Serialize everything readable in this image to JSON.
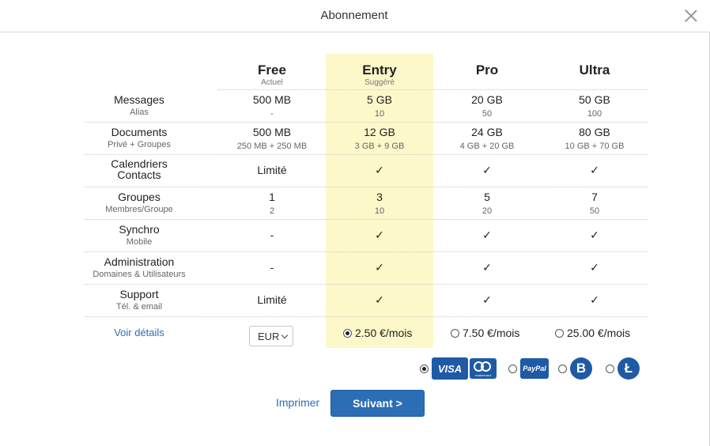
{
  "dialog": {
    "title": "Abonnement"
  },
  "plans": [
    {
      "name": "Free",
      "sub": "Actuel"
    },
    {
      "name": "Entry",
      "sub": "Suggéré"
    },
    {
      "name": "Pro",
      "sub": ""
    },
    {
      "name": "Ultra",
      "sub": ""
    }
  ],
  "rows": [
    {
      "label": "Messages",
      "label_sub": "Alias",
      "cells": [
        {
          "main": "500 MB",
          "sub": "-"
        },
        {
          "main": "5 GB",
          "sub": "10"
        },
        {
          "main": "20 GB",
          "sub": "50"
        },
        {
          "main": "50 GB",
          "sub": "100"
        }
      ]
    },
    {
      "label": "Documents",
      "label_sub": "Privé + Groupes",
      "cells": [
        {
          "main": "500 MB",
          "sub": "250 MB + 250 MB"
        },
        {
          "main": "12 GB",
          "sub": "3 GB + 9 GB"
        },
        {
          "main": "24 GB",
          "sub": "4 GB + 20 GB"
        },
        {
          "main": "80 GB",
          "sub": "10 GB + 70 GB"
        }
      ]
    },
    {
      "label": "Calendriers",
      "label_sub": "Contacts",
      "cells": [
        {
          "main": "Limité",
          "sub": ""
        },
        {
          "main": "✓",
          "sub": ""
        },
        {
          "main": "✓",
          "sub": ""
        },
        {
          "main": "✓",
          "sub": ""
        }
      ]
    },
    {
      "label": "Groupes",
      "label_sub": "Membres/Groupe",
      "cells": [
        {
          "main": "1",
          "sub": "2"
        },
        {
          "main": "3",
          "sub": "10"
        },
        {
          "main": "5",
          "sub": "20"
        },
        {
          "main": "7",
          "sub": "50"
        }
      ]
    },
    {
      "label": "Synchro",
      "label_sub": "Mobile",
      "cells": [
        {
          "main": "-",
          "sub": ""
        },
        {
          "main": "✓",
          "sub": ""
        },
        {
          "main": "✓",
          "sub": ""
        },
        {
          "main": "✓",
          "sub": ""
        }
      ]
    },
    {
      "label": "Administration",
      "label_sub": "Domaines & Utilisateurs",
      "cells": [
        {
          "main": "-",
          "sub": ""
        },
        {
          "main": "✓",
          "sub": ""
        },
        {
          "main": "✓",
          "sub": ""
        },
        {
          "main": "✓",
          "sub": ""
        }
      ]
    },
    {
      "label": "Support",
      "label_sub": "Tél. & email",
      "cells": [
        {
          "main": "Limité",
          "sub": ""
        },
        {
          "main": "✓",
          "sub": ""
        },
        {
          "main": "✓",
          "sub": ""
        },
        {
          "main": "✓",
          "sub": ""
        }
      ]
    }
  ],
  "details_link": "Voir détails",
  "currency": {
    "selected": "EUR"
  },
  "prices": [
    {
      "label": "2.50 €/mois",
      "selected": true
    },
    {
      "label": "7.50 €/mois",
      "selected": false
    },
    {
      "label": "25.00 €/mois",
      "selected": false
    }
  ],
  "payment": {
    "visa": "VISA",
    "mastercard": "mastercard",
    "paypal": "PayPal",
    "bitcoin": "B",
    "litecoin": "Ł",
    "selected": "visa"
  },
  "footer": {
    "print_label": "Imprimer",
    "next_label": "Suivant >"
  },
  "colors": {
    "accent": "#2b6eb6",
    "highlight": "#fdf8c9",
    "link": "#2a6db5"
  }
}
